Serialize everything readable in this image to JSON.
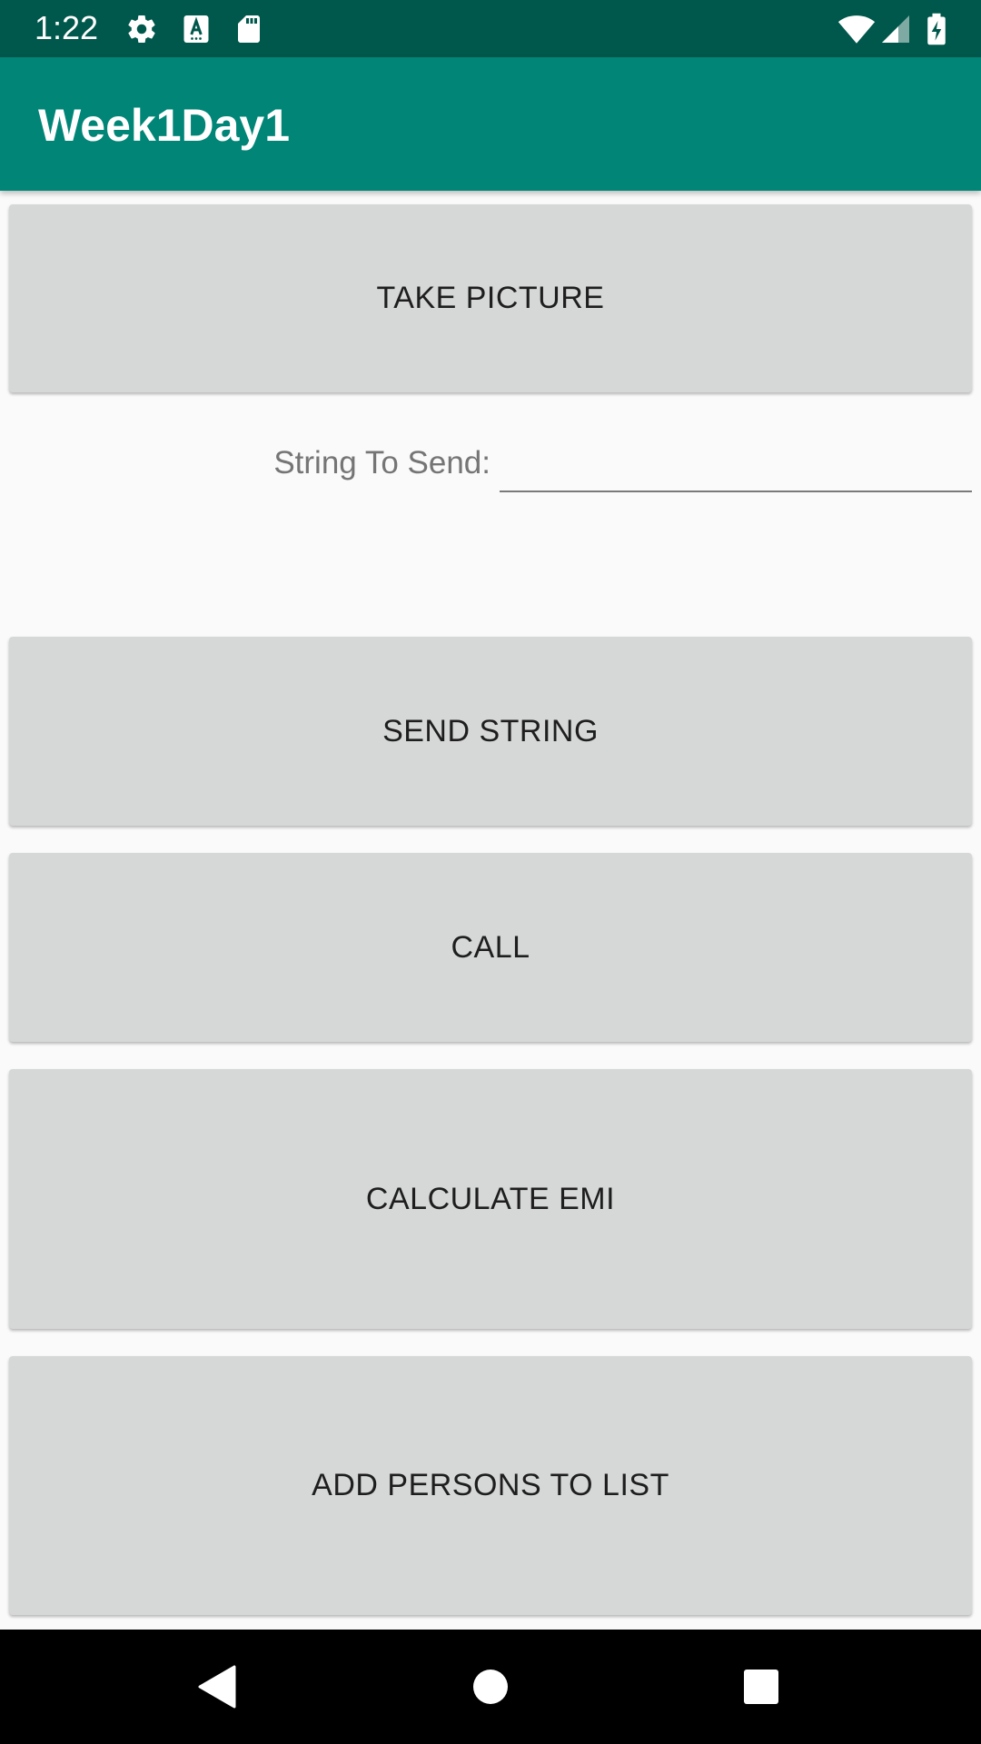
{
  "status_bar": {
    "time": "1:22",
    "icons": [
      "gear-icon",
      "a-keyboard-icon",
      "sd-card-icon",
      "wifi-icon",
      "cell-signal-icon",
      "battery-charging-icon"
    ]
  },
  "app_bar": {
    "title": "Week1Day1",
    "color": "#008577",
    "status_color": "#00574b"
  },
  "main": {
    "take_picture_label": "TAKE PICTURE",
    "string_label": "String To Send:",
    "string_value": "",
    "send_string_label": "SEND STRING",
    "call_label": "CALL",
    "calculate_emi_label": "CALCULATE EMI",
    "add_persons_label": "ADD PERSONS TO LIST",
    "button_color": "#d6d7d7"
  },
  "nav_bar": {
    "icons": [
      "back-icon",
      "home-icon",
      "recents-icon"
    ]
  }
}
